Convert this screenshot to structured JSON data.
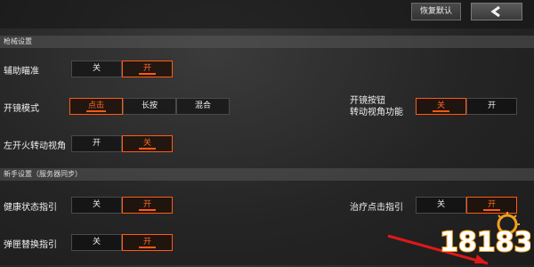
{
  "top": {
    "reset_label": "恢复默认",
    "back_icon": "chevron-left-icon"
  },
  "sections": {
    "firearm": "枪械设置",
    "newbie": "新手设置（服务器同步）"
  },
  "settings": {
    "aim_assist": {
      "label": "辅助瞄准",
      "options": [
        "关",
        "开"
      ],
      "selected": "开"
    },
    "scope_mode": {
      "label": "开镜模式",
      "options": [
        "点击",
        "长按",
        "混合"
      ],
      "selected": "点击"
    },
    "scope_button_rotate": {
      "label_line1": "开镜按钮",
      "label_line2": "转动视角功能",
      "options": [
        "关",
        "开"
      ],
      "selected": "关"
    },
    "left_fire_rotate": {
      "label": "左开火转动视角",
      "options": [
        "开",
        "关"
      ],
      "selected": "关"
    },
    "health_guide": {
      "label": "健康状态指引",
      "options": [
        "关",
        "开"
      ],
      "selected": "开"
    },
    "heal_click_guide": {
      "label": "治疗点击指引",
      "options": [
        "关",
        "开"
      ],
      "selected": "开"
    },
    "magazine_guide": {
      "label": "弹匣替换指引",
      "options": [
        "关",
        "开"
      ],
      "selected": "开"
    }
  },
  "watermark": {
    "text": "18183"
  },
  "colors": {
    "accent": "#ff5a14",
    "bg": "#262626"
  }
}
